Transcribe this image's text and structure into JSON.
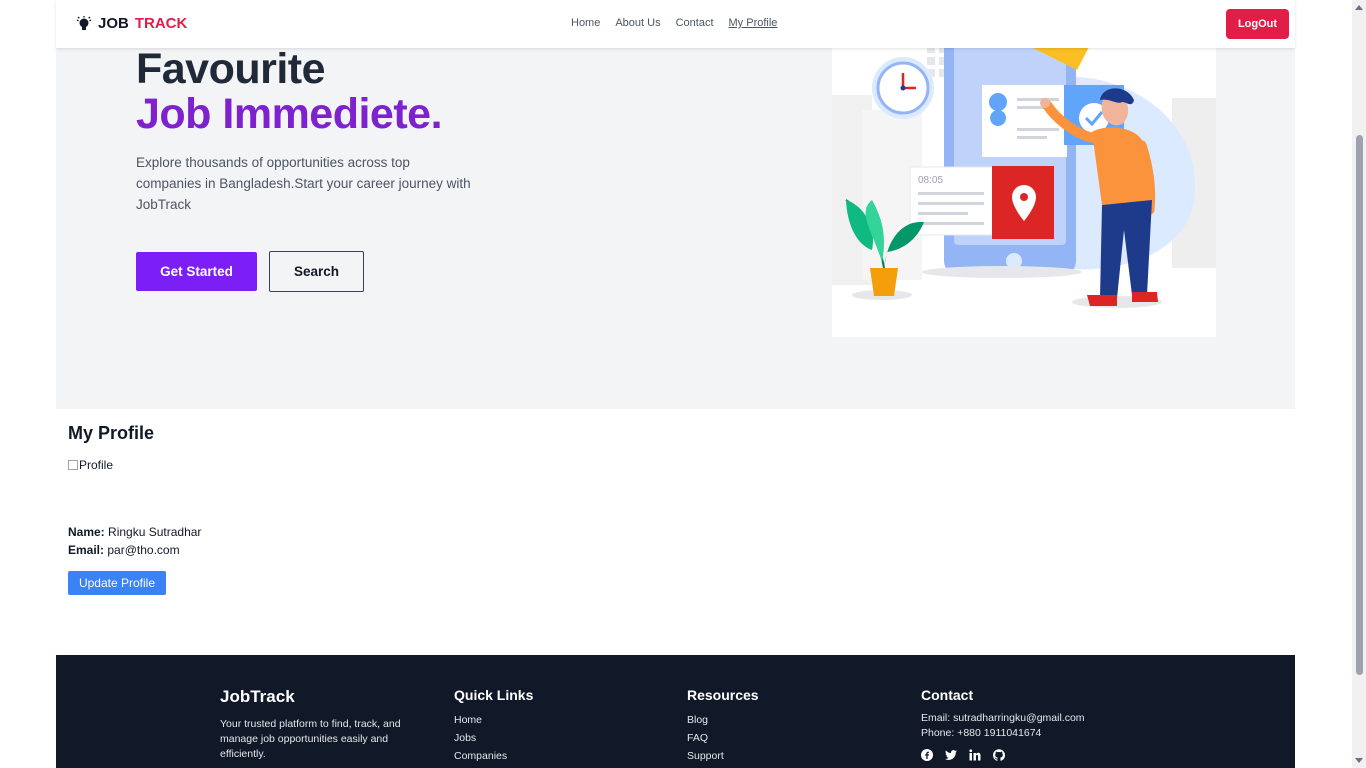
{
  "nav": {
    "brand_job": "JOB",
    "brand_track": "TRACK",
    "links": [
      "Home",
      "About Us",
      "Contact",
      "My Profile"
    ],
    "logout": "LogOut"
  },
  "hero": {
    "title_line1": "Favourite",
    "title_line2": "Job Immediete.",
    "description": "Explore thousands of opportunities across top companies in Bangladesh.Start your career journey with JobTrack",
    "get_started": "Get Started",
    "search": "Search"
  },
  "profile": {
    "heading": "My Profile",
    "image_alt": "Profile",
    "name_label": "Name:",
    "name_value": "Ringku Sutradhar",
    "email_label": "Email:",
    "email_value": "par@tho.com",
    "update_button": "Update Profile"
  },
  "footer": {
    "brand": "JobTrack",
    "tagline": "Your trusted platform to find, track, and manage job opportunities easily and efficiently.",
    "quick_links_title": "Quick Links",
    "quick_links": [
      "Home",
      "Jobs",
      "Companies"
    ],
    "resources_title": "Resources",
    "resources": [
      "Blog",
      "FAQ",
      "Support"
    ],
    "contact_title": "Contact",
    "email": "Email: sutradharringku@gmail.com",
    "phone": "Phone: +880 1911041674",
    "social_icons": [
      "facebook-icon",
      "twitter-icon",
      "linkedin-icon",
      "github-icon"
    ]
  },
  "colors": {
    "brand_red": "#e11d48",
    "purple_heading": "#7e22ce",
    "primary_button": "#7c1ff7",
    "update_button": "#3b82f6",
    "footer_bg": "#111827",
    "hero_bg": "#f3f4f6"
  }
}
